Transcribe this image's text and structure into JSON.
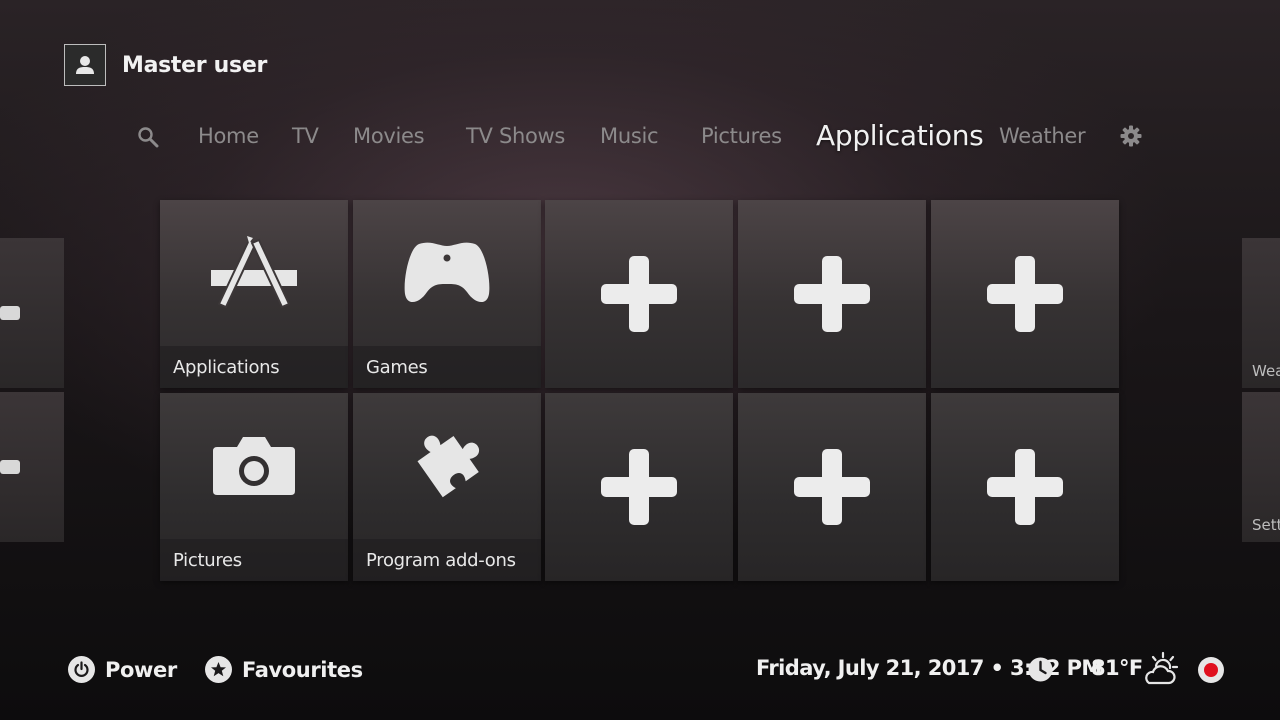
{
  "profile": {
    "name": "Master user",
    "icon": "user-icon"
  },
  "nav": {
    "search_icon": "search-icon",
    "items": [
      "Home",
      "TV",
      "Movies",
      "TV Shows",
      "Music",
      "Pictures",
      "Applications",
      "Weather"
    ],
    "active": "Applications",
    "settings_icon": "gear-icon"
  },
  "tiles": {
    "row1": [
      {
        "label": "Applications",
        "icon": "app-store-icon"
      },
      {
        "label": "Games",
        "icon": "gamepad-icon"
      },
      {
        "label": "",
        "icon": "add-icon"
      },
      {
        "label": "",
        "icon": "add-icon"
      },
      {
        "label": "",
        "icon": "add-icon"
      }
    ],
    "row2": [
      {
        "label": "Pictures",
        "icon": "camera-icon"
      },
      {
        "label": "Program add-ons",
        "icon": "puzzle-icon"
      },
      {
        "label": "",
        "icon": "add-icon"
      },
      {
        "label": "",
        "icon": "add-icon"
      },
      {
        "label": "",
        "icon": "add-icon"
      }
    ]
  },
  "side_peek": {
    "right_top": "Wea",
    "right_bottom": "Setti"
  },
  "bottom": {
    "power": "Power",
    "favourites": "Favourites",
    "datetime": "Friday, July 21, 2017 • 3:52 PM",
    "temperature": "81°F",
    "clock_icon": "clock-icon",
    "weather_icon": "partly-cloudy-icon",
    "record_icon": "record-icon"
  },
  "colors": {
    "record_red": "#e0101e",
    "text": "#f0f0f0",
    "nav_inactive": "#8c8a8b"
  }
}
